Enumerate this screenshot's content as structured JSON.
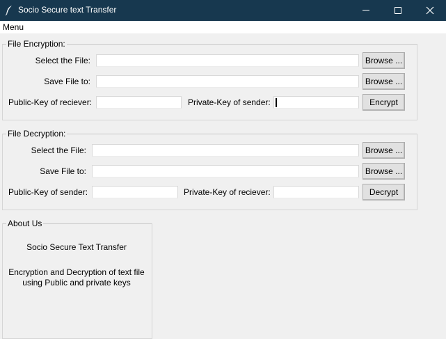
{
  "window": {
    "title": "Socio Secure text Transfer",
    "icon": "feather-icon",
    "controls": [
      "minimize-icon",
      "maximize-icon",
      "close-icon"
    ]
  },
  "menubar": {
    "items": [
      "Menu"
    ]
  },
  "encryption": {
    "legend": "File Encryption:",
    "select_file_label": "Select the File:",
    "select_file_value": "",
    "save_file_label": "Save File to:",
    "save_file_value": "",
    "public_key_label": "Public-Key of reciever:",
    "public_key_value": "",
    "private_key_label": "Private-Key of sender:",
    "private_key_value": "",
    "browse_select_label": "Browse ...",
    "browse_save_label": "Browse ...",
    "action_label": "Encrypt"
  },
  "decryption": {
    "legend": "File Decryption:",
    "select_file_label": "Select the File:",
    "select_file_value": "",
    "save_file_label": "Save File to:",
    "save_file_value": "",
    "public_key_label": "Public-Key of sender:",
    "public_key_value": "",
    "private_key_label": "Private-Key of reciever:",
    "private_key_value": "",
    "browse_select_label": "Browse ...",
    "browse_save_label": "Browse ...",
    "action_label": "Decrypt"
  },
  "about": {
    "legend": "About Us",
    "name": "Socio Secure Text Transfer",
    "desc_line1": "Encryption and Decryption of text file",
    "desc_line2": "using Public and private keys"
  }
}
